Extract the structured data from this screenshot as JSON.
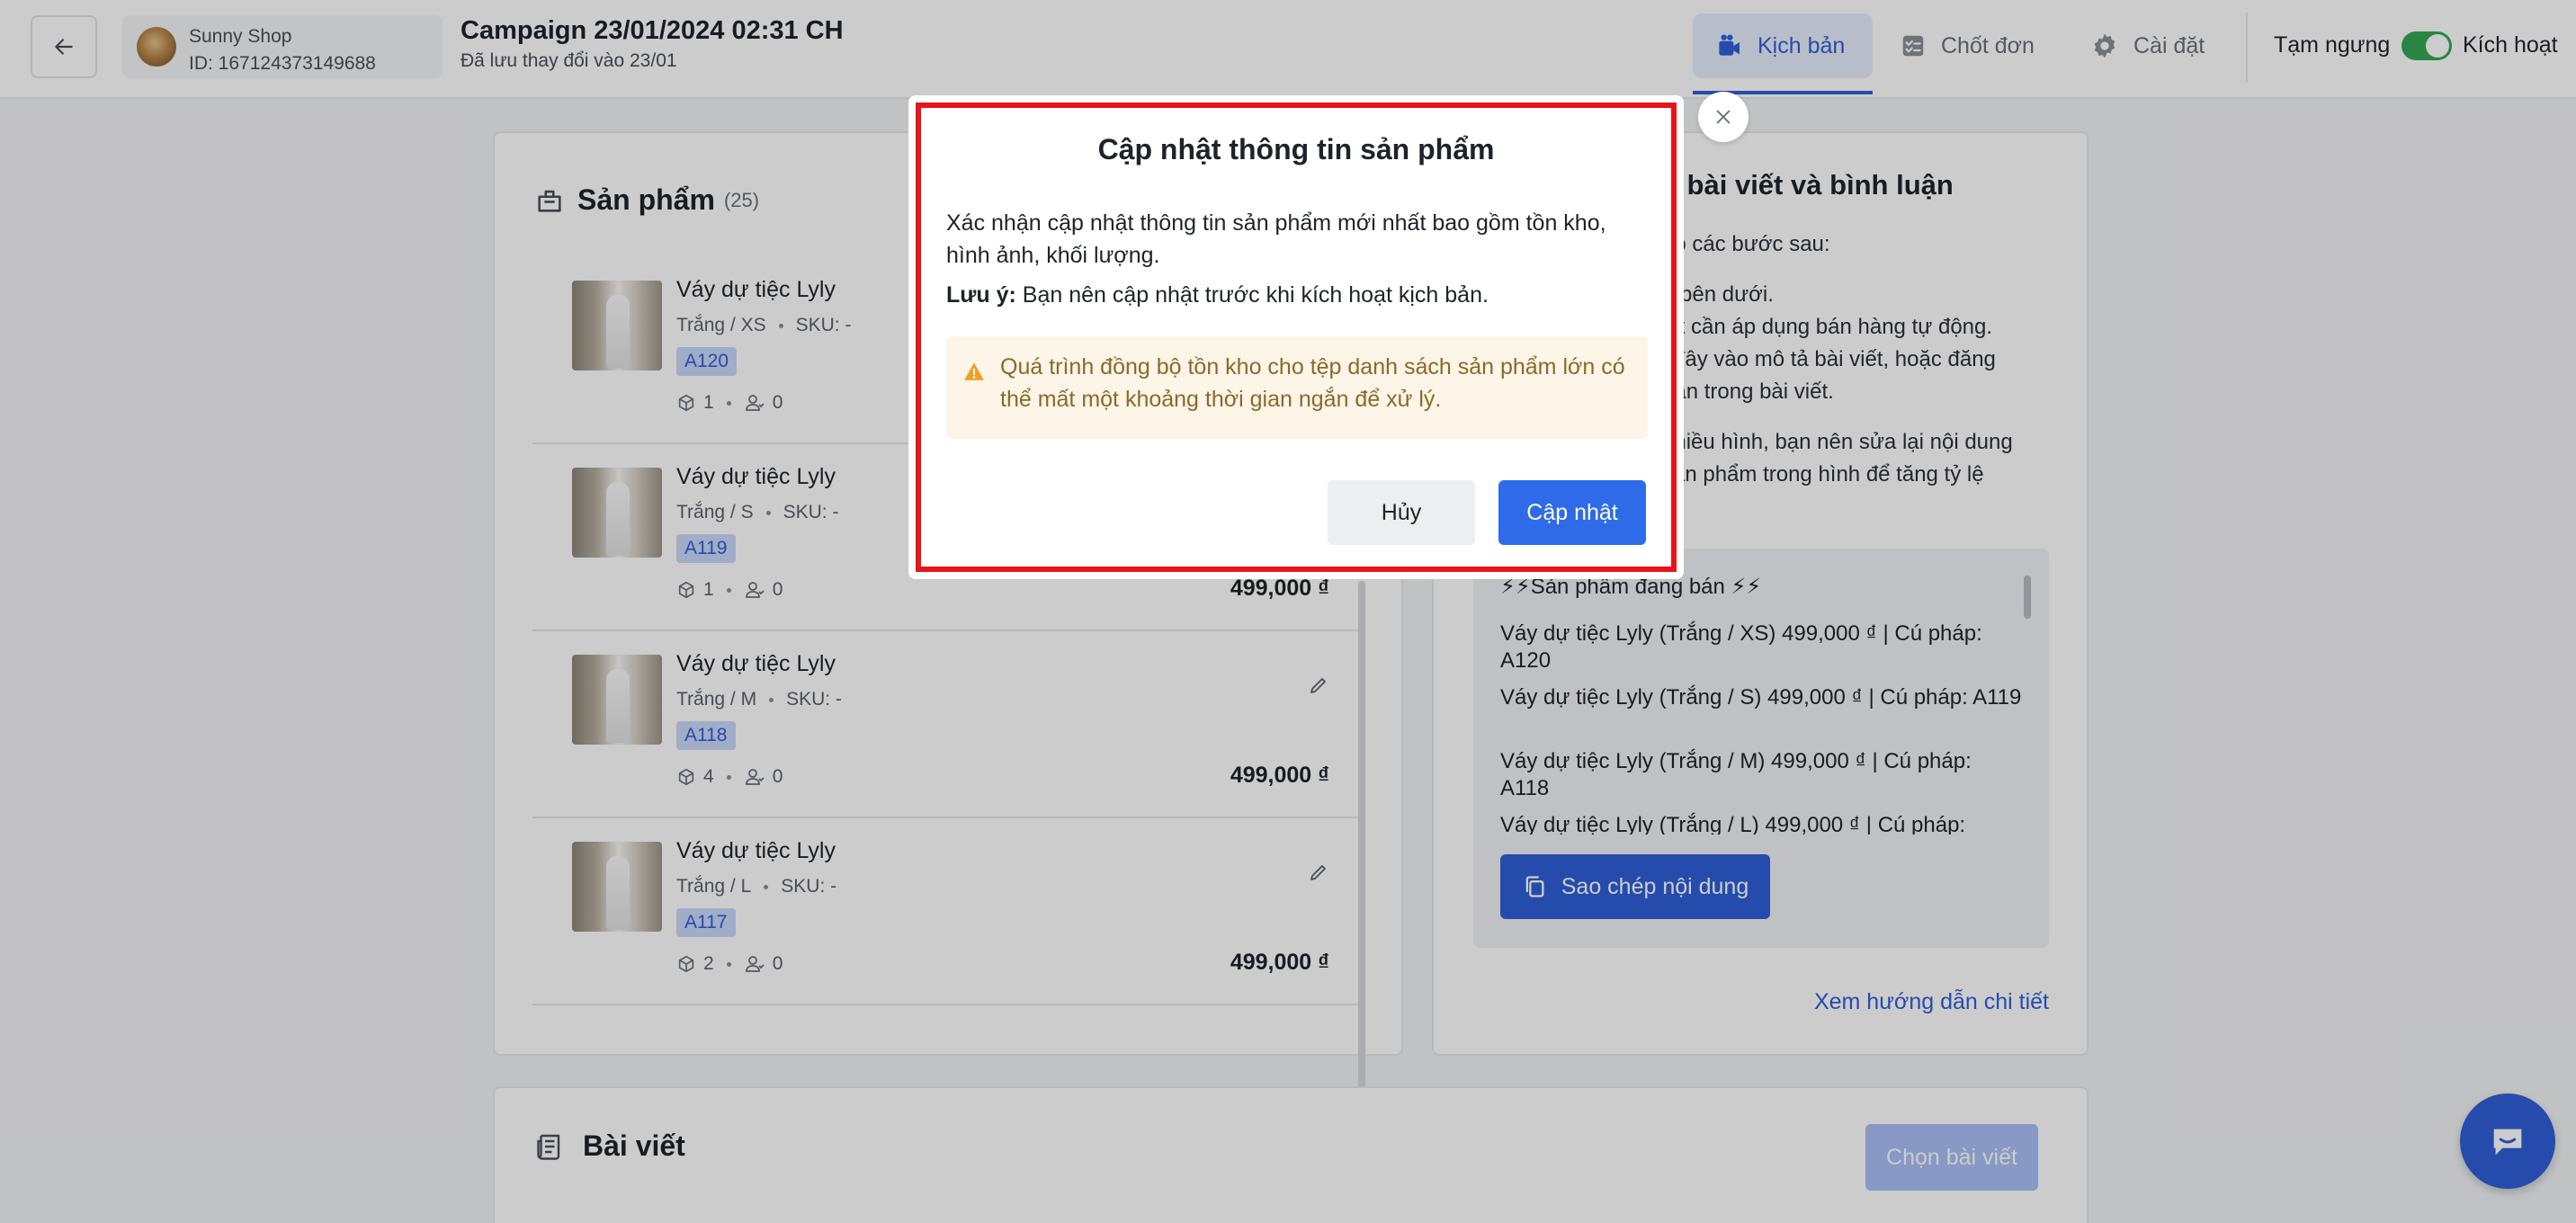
{
  "header": {
    "shop_name": "Sunny Shop",
    "shop_id": "ID: 167124373149688",
    "campaign_title": "Campaign 23/01/2024 02:31 CH",
    "saved_text": "Đã lưu thay đổi vào 23/01",
    "tabs": [
      {
        "label": "Kịch bản",
        "icon": "camera-icon",
        "active": true
      },
      {
        "label": "Chốt đơn",
        "icon": "checklist-icon",
        "active": false
      },
      {
        "label": "Cài đặt",
        "icon": "gear-icon",
        "active": false
      }
    ],
    "pause_label": "Tạm ngưng",
    "active_label": "Kích hoạt",
    "toggle_on": true
  },
  "products": {
    "title": "Sản phẩm",
    "count": "(25)",
    "items": [
      {
        "name": "Váy dự tiệc Lyly",
        "variant": "Trắng / XS",
        "sku": "SKU: -",
        "code": "A120",
        "stock": "1",
        "buyers": "0",
        "price": ""
      },
      {
        "name": "Váy dự tiệc Lyly",
        "variant": "Trắng / S",
        "sku": "SKU: -",
        "code": "A119",
        "stock": "1",
        "buyers": "0",
        "price": "499,000 ₫"
      },
      {
        "name": "Váy dự tiệc Lyly",
        "variant": "Trắng / M",
        "sku": "SKU: -",
        "code": "A118",
        "stock": "4",
        "buyers": "0",
        "price": "499,000 ₫"
      },
      {
        "name": "Váy dự tiệc Lyly",
        "variant": "Trắng / L",
        "sku": "SKU: -",
        "code": "A117",
        "stock": "2",
        "buyers": "0",
        "price": "499,000 ₫"
      }
    ]
  },
  "guide": {
    "title": "g bài viết và bình luận",
    "lines": [
      "eo các bước sau:",
      "g bên dưới.",
      "iết cần áp dụng bán hàng tự động.",
      "i đây vào mô tả bài viết, hoặc đăng",
      "uận trong bài viết.",
      "nhiều hình, bạn nên sửa lại nội dung",
      "sản phẩm trong hình để tăng tỷ lệ"
    ],
    "copy_header": "⚡⚡Sản phẩm đang bán ⚡⚡",
    "copy_lines": [
      "Váy dự tiệc Lyly (Trắng / XS) 499,000 ₫ | Cú pháp: A120",
      "Váy dự tiệc Lyly (Trắng / S) 499,000 ₫ | Cú pháp: A119",
      "Váy dự tiệc Lyly (Trắng / M) 499,000 ₫ | Cú pháp: A118",
      "Váy dự tiệc Lyly (Trắng / L) 499,000 ₫ | Cú pháp:"
    ],
    "copy_button": "Sao chép nội dung",
    "detail_link": "Xem hướng dẫn chi tiết"
  },
  "posts": {
    "title": "Bài viết",
    "choose_button": "Chọn bài viết"
  },
  "modal": {
    "title": "Cập nhật thông tin sản phẩm",
    "body": "Xác nhận cập nhật thông tin sản phẩm mới nhất bao gồm tồn kho, hình ảnh, khối lượng.",
    "note_label": "Lưu ý:",
    "note_text": " Bạn nên cập nhật trước khi kích hoạt kịch bản.",
    "warning": "Quá trình đồng bộ tồn kho cho tệp danh sách sản phẩm lớn có thể mất một khoảng thời gian ngắn để xử lý.",
    "cancel_label": "Hủy",
    "update_label": "Cập nhật"
  },
  "colors": {
    "primary": "#2f5fd8",
    "highlight_border": "#e8141b",
    "toggle_on": "#34a853",
    "warning_bg": "#fdf5e7"
  }
}
